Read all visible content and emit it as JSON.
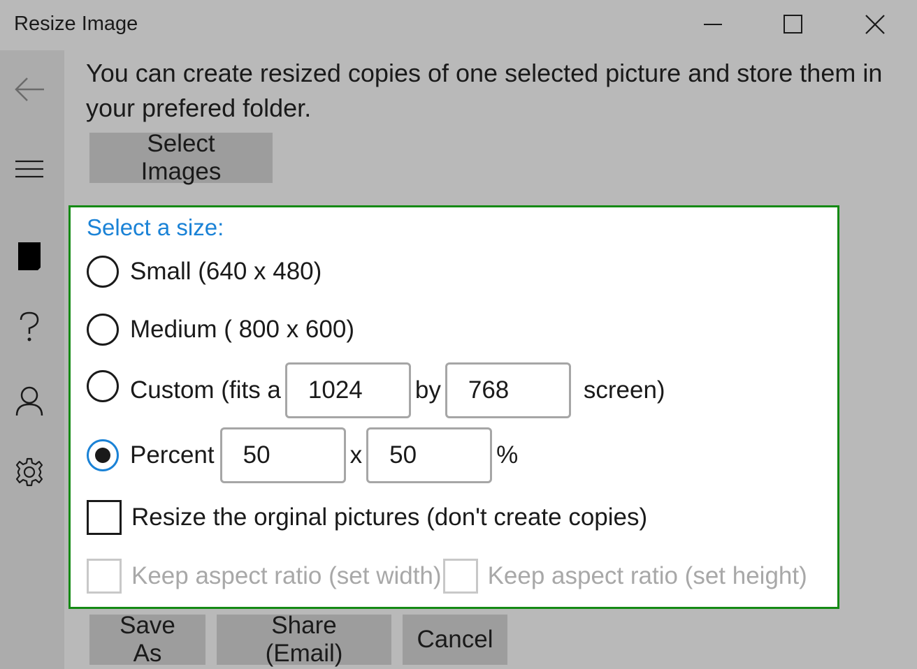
{
  "window": {
    "title": "Resize Image",
    "minimize_icon": "minimize-icon",
    "maximize_icon": "maximize-icon",
    "close_icon": "close-icon"
  },
  "sidebar": {
    "items": [
      {
        "icon": "back-arrow-icon"
      },
      {
        "icon": "hamburger-menu-icon"
      },
      {
        "icon": "document-icon"
      },
      {
        "icon": "help-icon"
      },
      {
        "icon": "user-icon"
      },
      {
        "icon": "settings-gear-icon"
      }
    ]
  },
  "intro_text": "You can create resized copies of one selected picture and store them in your prefered folder.",
  "select_images_label": "Select Images",
  "size_panel": {
    "heading": "Select a size:",
    "small_label": "Small (640 x 480)",
    "medium_label": "Medium ( 800 x 600)",
    "custom": {
      "prefix": "Custom (fits a",
      "width": "1024",
      "by": "by",
      "height": "768",
      "suffix": "screen)"
    },
    "percent": {
      "label": "Percent",
      "width": "50",
      "x": "x",
      "height": "50",
      "unit": "%"
    },
    "selected_option": "percent",
    "resize_original_label": "Resize the orginal pictures (don't create copies)",
    "keep_aspect_width_label": "Keep aspect ratio (set width)",
    "keep_aspect_height_label": "Keep aspect ratio (set height)"
  },
  "actions": {
    "save_as": "Save As",
    "share_email": "Share (Email)",
    "cancel": "Cancel"
  },
  "colors": {
    "accent": "#1a82d6",
    "panel_border": "#148a14",
    "background": "#b9b9b9",
    "sidebar": "#acacac"
  }
}
